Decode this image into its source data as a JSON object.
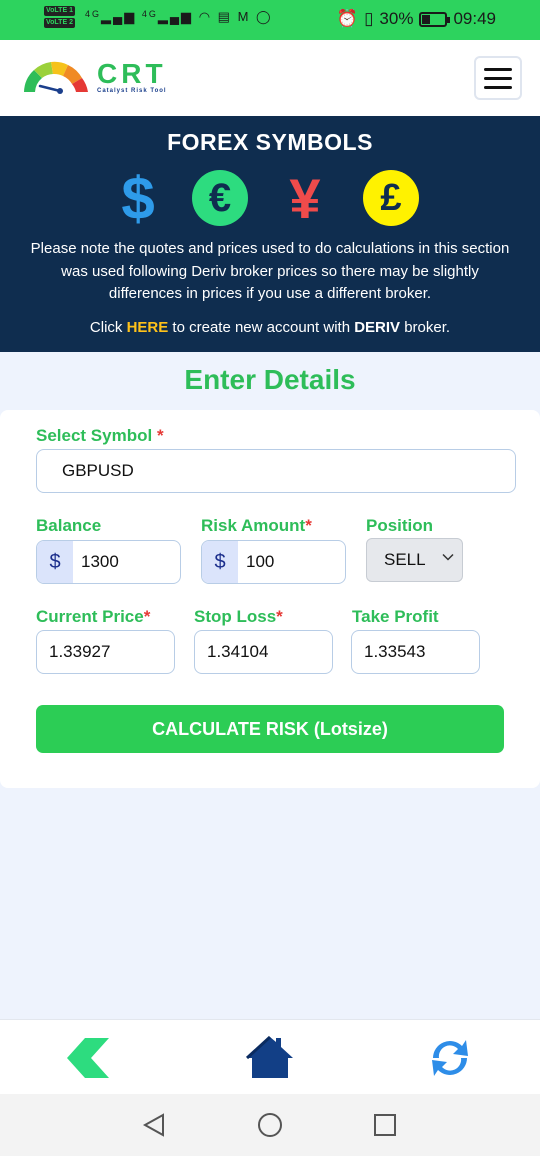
{
  "status_bar": {
    "left_badges": [
      "VoLTE 1",
      "VoLTE 2"
    ],
    "network": [
      "4G",
      "4G"
    ],
    "battery_percent_text": "30%",
    "battery_level": 0.3,
    "time": "09:49"
  },
  "header": {
    "logo_title": "CRT",
    "logo_subtitle": "Catalyst Risk Tool"
  },
  "banner": {
    "title": "FOREX SYMBOLS",
    "symbols": [
      "$",
      "€",
      "¥",
      "£"
    ],
    "note": "Please note the quotes and prices used to do calculations in this section was used following Deriv broker prices so there may be slightly differences in prices if you use a different broker.",
    "link_prefix": "Click ",
    "link_here": "HERE",
    "link_middle": " to create new account with ",
    "link_broker": "DERIV",
    "link_suffix": " broker."
  },
  "form": {
    "section_title": "Enter Details",
    "symbol_label": "Select Symbol ",
    "symbol_value": "GBPUSD",
    "balance_label": "Balance",
    "balance_currency": "$",
    "balance_value": "1300",
    "risk_label": "Risk Amount",
    "risk_currency": "$",
    "risk_value": "100",
    "position_label": "Position",
    "position_value": "SELL",
    "current_price_label": "Current Price",
    "current_price_value": "1.33927",
    "stop_loss_label": "Stop Loss",
    "stop_loss_value": "1.34104",
    "take_profit_label": "Take Profit",
    "take_profit_value": "1.33543",
    "required_mark": "*",
    "calculate_label": "CALCULATE RISK (Lotsize)"
  },
  "colors": {
    "status_green": "#2dd35e",
    "banner_navy": "#0f2d4f",
    "accent_green": "#2ebd59",
    "here_yellow": "#ffc21a",
    "required_red": "#e53935"
  },
  "icons": {
    "bottom_nav": [
      "back-chevron-icon",
      "home-icon",
      "refresh-icon"
    ],
    "system_nav": [
      "back-triangle-icon",
      "home-circle-icon",
      "recents-square-icon"
    ]
  }
}
